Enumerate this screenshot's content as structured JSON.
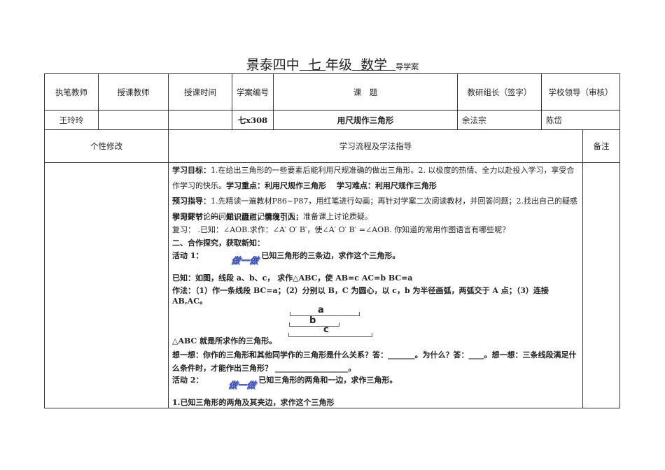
{
  "title": {
    "school": "景泰四中",
    "grade": "七",
    "grade_suffix": "年级",
    "subject": "数学",
    "suffix": "导学案"
  },
  "header": [
    "执笔教师",
    "授课教师",
    "授课时间",
    "学案编号",
    "课　题",
    "教研组长（签字）",
    "学校领导（审核）"
  ],
  "values": [
    "王玲玲",
    "",
    "",
    "七x308",
    "用尺规作三角形",
    "余法宗",
    "陈岱"
  ],
  "section": {
    "left": "个性修改",
    "middle": "学习流程及学法指导",
    "right": "备注"
  },
  "content": {
    "goal_label": "学习目标：",
    "goal": "1.在给出三角形的一些要素后能利用尺规准确的做出三角形。2. 以极度的热情、全力以赴投入学习，享受合作学习的快乐。",
    "key": "学习重点：利用尺规作三角形　 学习难点：利用尺规作三角形",
    "preview_label": "预习指导：",
    "preview": "1.先精读一遍教材P86~P87，用红笔进行勾画；再针对学案二次阅读教材，并回答问题；2.找出自己的疑惑和需要讨论的问题，随时记录在下面，准备课上讨论质疑。",
    "step1": "学习环节：一、知识盘点，情境引入：",
    "review": "复习： .已知：∠AOB.求作：∠A′ O′ B′，使∠A′ O′ B′ =∠AOB.  你知道的常用作图语言有哪些呢？",
    "step2": "二、合作探究，获取新知：",
    "act1_label": "活动 1：",
    "stamp": "做一做",
    "act1": "已知三角形的三条边，求作这个三角形。",
    "known": "已知：如图，线段 a、b、c， 求作△ABC，使 AB=c  AC=b  BC=a",
    "method": "作法：（1）作一条线段 BC=a；（2）分别以 B，C 为圆心，以 c，b 为半径画弧，两弧交于 A 点；（3）连接 AB,AC。",
    "seg_a": "a",
    "seg_b": "b",
    "seg_c": "c",
    "done": "△ABC 就是所求作的三角形。",
    "think": "想一想：你作的三角形和其他同学作的三角形是什么关系？答：_______。为什么？答：____。想一想：三条线段满足什么条件时，才能作出三角形？ ___________________。",
    "act2_label": "活动 2：",
    "act2": "已知三角形的两角和一边，求作三角形。",
    "sub1": "1.已知三角形的两角及其夹边，求作这个三角形"
  }
}
